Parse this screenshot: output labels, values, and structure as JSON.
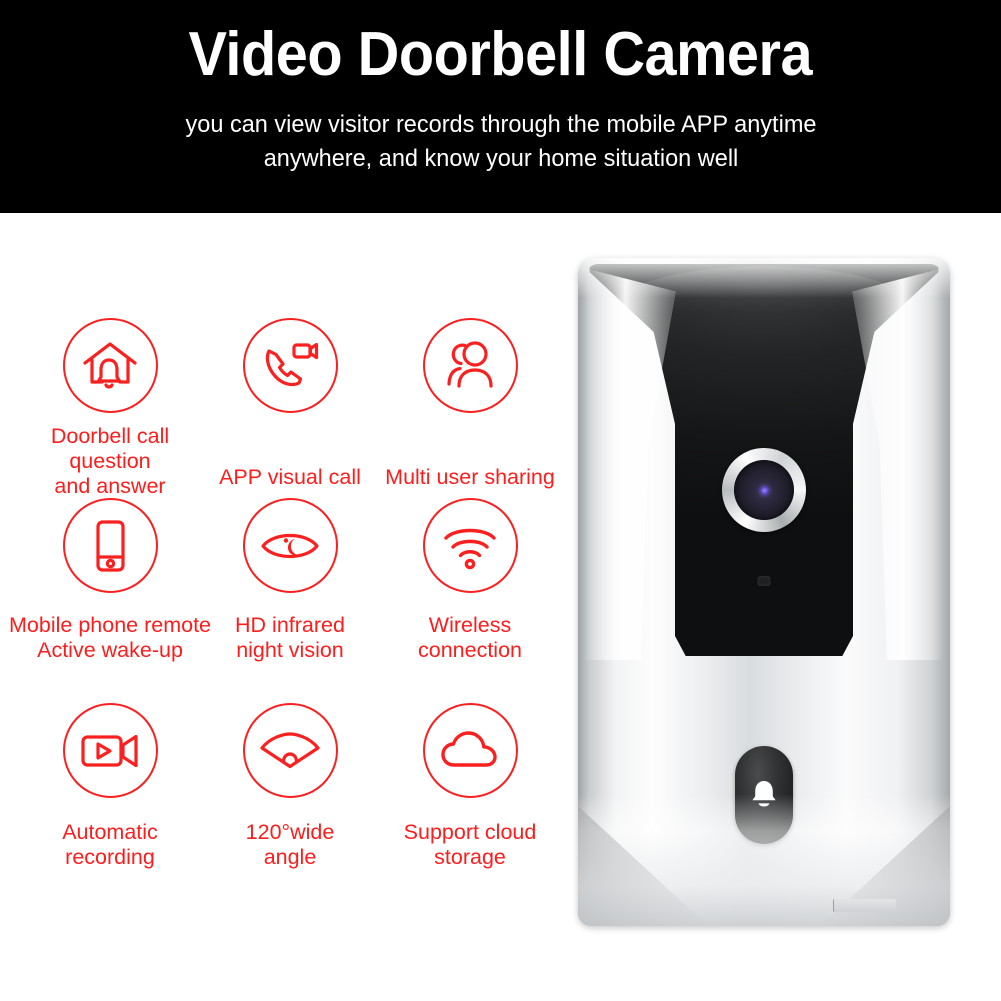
{
  "header": {
    "title": "Video Doorbell Camera",
    "subtitle_lines": [
      "you can view visitor records through the mobile APP anytime",
      "anywhere, and know your home situation well"
    ],
    "background_color": "#000000",
    "text_color": "#ffffff"
  },
  "theme": {
    "accent_color": "#fc1d1c",
    "page_background": "#ffffff"
  },
  "features": [
    {
      "icon": "house-bell-icon",
      "label_lines": [
        "Doorbell call",
        "question",
        "and answer"
      ]
    },
    {
      "icon": "video-call-icon",
      "label_lines": [
        "APP visual call"
      ]
    },
    {
      "icon": "multi-user-icon",
      "label_lines": [
        "Multi user sharing"
      ]
    },
    {
      "icon": "smartphone-icon",
      "label_lines": [
        "Mobile phone remote",
        "Active wake-up"
      ]
    },
    {
      "icon": "night-vision-eye-icon",
      "label_lines": [
        "HD infrared",
        "night vision"
      ]
    },
    {
      "icon": "wifi-icon",
      "label_lines": [
        "Wireless",
        "connection"
      ]
    },
    {
      "icon": "camcorder-play-icon",
      "label_lines": [
        "Automatic",
        "recording"
      ]
    },
    {
      "icon": "wide-angle-fan-icon",
      "label_lines": [
        "120°wide",
        "angle"
      ]
    },
    {
      "icon": "cloud-icon",
      "label_lines": [
        "Support cloud",
        "storage"
      ]
    }
  ],
  "product": {
    "name": "video-doorbell-unit",
    "body_color": "#e9ebed",
    "faceplate_color": "#1a1b1c",
    "button_icon": "bell-glyph",
    "lens_icon": "camera-lens"
  }
}
